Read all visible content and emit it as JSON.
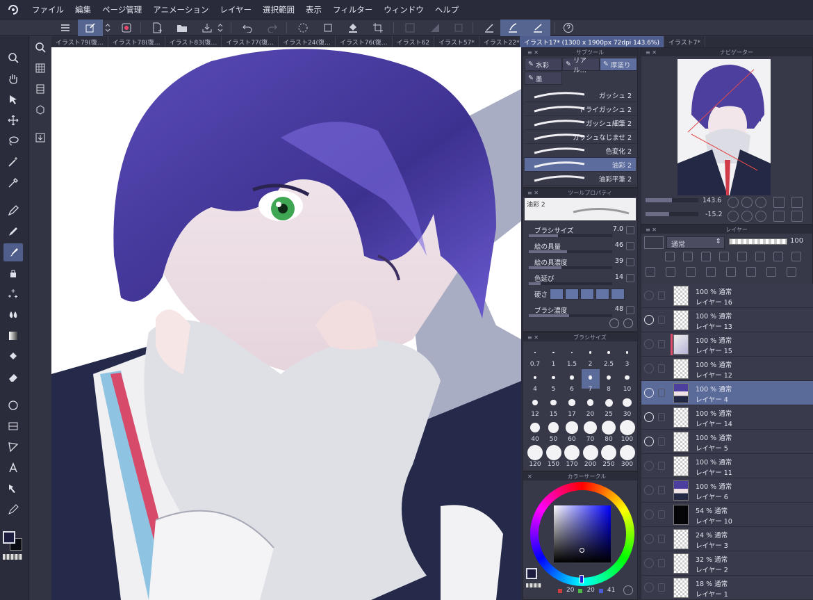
{
  "menu": {
    "items": [
      "ファイル",
      "編集",
      "ページ管理",
      "アニメーション",
      "レイヤー",
      "選択範囲",
      "表示",
      "フィルター",
      "ウィンドウ",
      "ヘルプ"
    ]
  },
  "tabs": [
    "イラスト79(復…",
    "イラスト78(復…",
    "イラスト83(復…",
    "イラスト77(復…",
    "イラスト24(復…",
    "イラスト76(復…",
    "イラスト62",
    "イラスト57*",
    "イラスト22*"
  ],
  "tabs_right": [
    "イラスト17* (1300 x 1900px 72dpi 143.6%)",
    "イラスト7*"
  ],
  "subtool": {
    "title": "サブツール",
    "tabs": [
      "水彩",
      "リアル…",
      "厚塗り",
      "墨"
    ],
    "brushes": [
      "ガッシュ 2",
      "ドライガッシュ 2",
      "ガッシュ細筆 2",
      "ガッシュなじませ 2",
      "色変化 2",
      "油彩 2",
      "油彩平筆 2"
    ]
  },
  "toolprop": {
    "title": "ツールプロパティ",
    "name": "油彩 2",
    "rows": [
      {
        "label": "ブラシサイズ",
        "value": "7.0",
        "level": 0.35
      },
      {
        "label": "絵の具量",
        "value": "46",
        "level": 0.46
      },
      {
        "label": "絵の具濃度",
        "value": "39",
        "level": 0.39
      },
      {
        "label": "色延び",
        "value": "14",
        "level": 0.14
      },
      {
        "label": "硬さ",
        "value": ""
      },
      {
        "label": "ブラシ濃度",
        "value": "48",
        "level": 0.48
      }
    ]
  },
  "brushsize": {
    "title": "ブラシサイズ",
    "sizes": [
      "0.7",
      "1",
      "1.5",
      "2",
      "2.5",
      "3",
      "4",
      "5",
      "6",
      "7",
      "8",
      "10",
      "12",
      "15",
      "17",
      "20",
      "25",
      "30",
      "40",
      "50",
      "60",
      "70",
      "80",
      "100",
      "120",
      "150",
      "170",
      "200",
      "250",
      "300"
    ]
  },
  "colorwheel": {
    "title": "カラーサークル",
    "r": "20",
    "g": "20",
    "b": "41",
    "r_color": "#d23c3c",
    "g_color": "#4cbb4c",
    "b_color": "#4c5cdb"
  },
  "navigator": {
    "title": "ナビゲーター",
    "zoom": "143.6",
    "angle": "-15.2"
  },
  "layers": {
    "title": "レイヤー",
    "blend": "通常",
    "opacity": "100",
    "items": [
      {
        "opacity": "100 %",
        "mode": "通常",
        "name": "レイヤー 16",
        "visible": false,
        "active": false,
        "kind": "blank"
      },
      {
        "opacity": "100 %",
        "mode": "通常",
        "name": "レイヤー 13",
        "visible": true,
        "active": false,
        "kind": "blank"
      },
      {
        "opacity": "100 %",
        "mode": "通常",
        "name": "レイヤー 15",
        "visible": false,
        "active": false,
        "kind": "sketch"
      },
      {
        "opacity": "100 %",
        "mode": "通常",
        "name": "レイヤー 12",
        "visible": false,
        "active": false,
        "kind": "blank"
      },
      {
        "opacity": "100 %",
        "mode": "通常",
        "name": "レイヤー 4",
        "visible": true,
        "active": true,
        "kind": "portrait"
      },
      {
        "opacity": "100 %",
        "mode": "通常",
        "name": "レイヤー 14",
        "visible": true,
        "active": false,
        "kind": "blank"
      },
      {
        "opacity": "100 %",
        "mode": "通常",
        "name": "レイヤー 5",
        "visible": true,
        "active": false,
        "kind": "blank"
      },
      {
        "opacity": "100 %",
        "mode": "通常",
        "name": "レイヤー 11",
        "visible": false,
        "active": false,
        "kind": "blank"
      },
      {
        "opacity": "100 %",
        "mode": "通常",
        "name": "レイヤー 6",
        "visible": false,
        "active": false,
        "kind": "portrait"
      },
      {
        "opacity": "54 %",
        "mode": "通常",
        "name": "レイヤー 10",
        "visible": false,
        "active": false,
        "kind": "dark"
      },
      {
        "opacity": "24 %",
        "mode": "通常",
        "name": "レイヤー 3",
        "visible": false,
        "active": false,
        "kind": "blank"
      },
      {
        "opacity": "32 %",
        "mode": "通常",
        "name": "レイヤー 2",
        "visible": false,
        "active": false,
        "kind": "blank"
      },
      {
        "opacity": "18 %",
        "mode": "通常",
        "name": "レイヤー 1",
        "visible": false,
        "active": false,
        "kind": "blank"
      }
    ]
  },
  "colors": {
    "accent": "#5a6a99",
    "hair": "#4d3f9e",
    "eye": "#3fa653",
    "background": "#2d2e3d"
  }
}
